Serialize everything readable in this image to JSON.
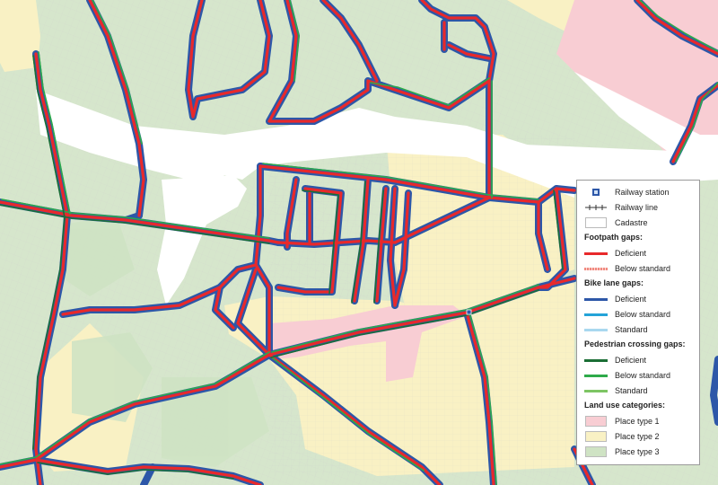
{
  "map": {
    "colors": {
      "base_green": "#d6e6cc",
      "place1": "#f8cdd3",
      "place2": "#f9f1c4",
      "place3": "#cfe3c4",
      "cadastre_white": "#ffffff",
      "parcel_lines": "#c8c8c8",
      "footpath_deficient": "#e8292b",
      "footpath_below": "#f08a80",
      "bike_deficient": "#2d57a8",
      "bike_below": "#24a3d8",
      "bike_standard": "#a9d8ef",
      "ped_deficient": "#1b6e35",
      "ped_below": "#2eaa4a",
      "ped_standard": "#7dc564"
    }
  },
  "legend": {
    "items": [
      {
        "id": "railway-station",
        "label": "Railway station",
        "symbol": "square-station-icon"
      },
      {
        "id": "railway-line",
        "label": "Railway line",
        "symbol": "railway-line-icon"
      },
      {
        "id": "cadastre",
        "label": "Cadastre",
        "symbol": "patch",
        "color": "#ffffff"
      }
    ],
    "groups": [
      {
        "title": "Footpath gaps:",
        "items": [
          {
            "label": "Deficient",
            "color": "#e8292b",
            "style": "solid"
          },
          {
            "label": "Below standard",
            "color": "#f08a80",
            "style": "dotted"
          }
        ]
      },
      {
        "title": "Bike lane gaps:",
        "items": [
          {
            "label": "Deficient",
            "color": "#2d57a8",
            "style": "solid"
          },
          {
            "label": "Below standard",
            "color": "#24a3d8",
            "style": "solid"
          },
          {
            "label": "Standard",
            "color": "#a9d8ef",
            "style": "solid"
          }
        ]
      },
      {
        "title": "Pedestrian crossing gaps:",
        "items": [
          {
            "label": "Deficient",
            "color": "#1b6e35",
            "style": "solid"
          },
          {
            "label": "Below standard",
            "color": "#2eaa4a",
            "style": "solid"
          },
          {
            "label": "Standard",
            "color": "#7dc564",
            "style": "solid"
          }
        ]
      },
      {
        "title": "Land use categories:",
        "items": [
          {
            "label": "Place type 1",
            "color": "#f8cdd3",
            "style": "patch"
          },
          {
            "label": "Place type 2",
            "color": "#f9f1c4",
            "style": "patch"
          },
          {
            "label": "Place type 3",
            "color": "#cfe3c4",
            "style": "patch"
          }
        ]
      }
    ]
  }
}
